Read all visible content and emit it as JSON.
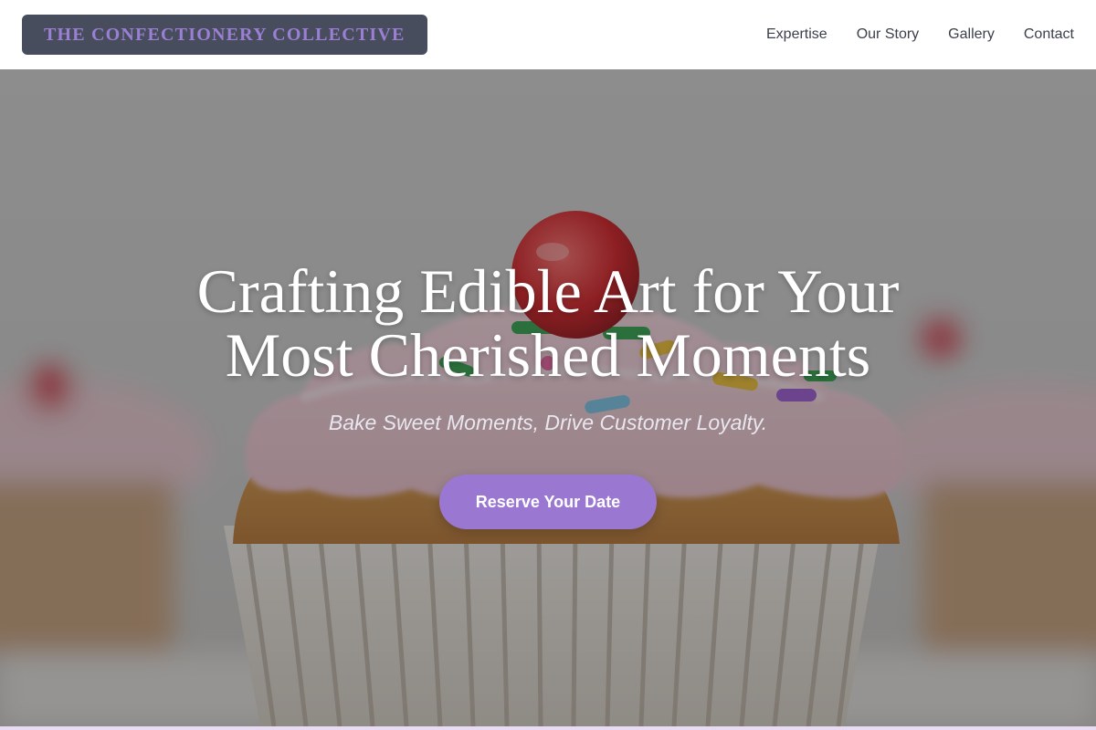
{
  "header": {
    "brand": "THE CONFECTIONERY COLLECTIVE",
    "nav": [
      {
        "label": "Expertise"
      },
      {
        "label": "Our Story"
      },
      {
        "label": "Gallery"
      },
      {
        "label": "Contact"
      }
    ]
  },
  "hero": {
    "title_line1": "Crafting Edible Art for Your",
    "title_line2": "Most Cherished Moments",
    "tagline": "Bake Sweet Moments, Drive Customer Loyalty.",
    "cta_label": "Reserve Your Date",
    "image_subject": "cupcake-with-pink-frosting-and-cherry"
  },
  "colors": {
    "brand_bg": "#474d5c",
    "brand_text": "#9b7fd4",
    "accent": "#9a78d1",
    "nav_text": "#3a3f4b"
  }
}
